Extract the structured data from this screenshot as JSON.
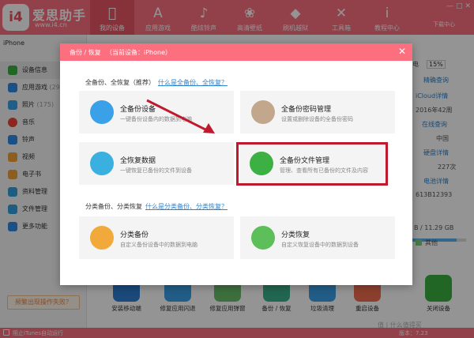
{
  "app": {
    "brand": "爱思助手",
    "url": "www.i4.cn",
    "logo_text": "i4"
  },
  "nav": [
    {
      "label": "我的设备",
      "icon": "apple-icon",
      "glyph": ""
    },
    {
      "label": "应用游戏",
      "icon": "app-store-icon",
      "glyph": "A"
    },
    {
      "label": "酷炫铃声",
      "icon": "bell-icon",
      "glyph": "♪"
    },
    {
      "label": "高清壁纸",
      "icon": "flower-icon",
      "glyph": "❀"
    },
    {
      "label": "刷机越狱",
      "icon": "dropbox-icon",
      "glyph": "◆"
    },
    {
      "label": "工具箱",
      "icon": "tools-icon",
      "glyph": "✕"
    },
    {
      "label": "教程中心",
      "icon": "info-icon",
      "glyph": "i"
    }
  ],
  "window_controls": "— □ ✕",
  "download_label": "下载中心",
  "sidebar": {
    "device": "iPhone",
    "items": [
      {
        "label": "设备信息",
        "count": "",
        "color": "#3cb043"
      },
      {
        "label": "应用游戏",
        "count": "(29)",
        "color": "#2e8be6"
      },
      {
        "label": "照片",
        "count": "(175)",
        "color": "#39a0e8"
      },
      {
        "label": "音乐",
        "count": "",
        "color": "#f0443a"
      },
      {
        "label": "铃声",
        "count": "",
        "color": "#2e8be6"
      },
      {
        "label": "视频",
        "count": "",
        "color": "#f2a33a"
      },
      {
        "label": "电子书",
        "count": "",
        "color": "#f2a33a"
      },
      {
        "label": "资料管理",
        "count": "",
        "color": "#33a0e0"
      },
      {
        "label": "文件管理",
        "count": "",
        "color": "#33a0e0"
      },
      {
        "label": "更多功能",
        "count": "",
        "color": "#2e8be6"
      }
    ],
    "fix_button": "频繁出现操作失败？"
  },
  "right_panel": {
    "battery_label": "电",
    "battery_pct": "15%",
    "lines": [
      "精确查询",
      "iCloud详情",
      "2016年42周",
      "在线查询",
      "中国",
      "硬盘详情",
      "227次",
      "电池详情",
      "613B12393"
    ],
    "storage_text": "B / 11.29 GB",
    "storage_fraction": 0.85,
    "legend": "其他"
  },
  "bottom_apps": [
    {
      "label": "安装移动端",
      "color": "#2d7fd3"
    },
    {
      "label": "修复应用闪退",
      "color": "#3aa0e8"
    },
    {
      "label": "修复应用弹窗",
      "color": "#6abf69"
    },
    {
      "label": "备份 / 恢复",
      "color": "#3ab08a"
    },
    {
      "label": "垃圾清理",
      "color": "#3aa0e8"
    },
    {
      "label": "重启设备",
      "color": "#f26d4f"
    },
    {
      "label": "关闭设备",
      "color": "#3cb043"
    }
  ],
  "statusbar": {
    "autostart": "阻止iTunes自动运行",
    "version": "版本：7.23"
  },
  "dialog": {
    "title": "备份 / 恢复",
    "subtitle": "（当前设备：iPhone）",
    "section1": "全备份、全恢复（推荐）",
    "section1_link": "什么是全备份、全恢复？",
    "section2": "分类备份、分类恢复",
    "section2_link": "什么是分类备份、分类恢复？",
    "cards": [
      {
        "title": "全备份设备",
        "desc": "一键备份设备内的数据到电脑",
        "color": "#3aa0e8",
        "icon": "clock-icon"
      },
      {
        "title": "全备份密码管理",
        "desc": "设置或删除设备的全备份密码",
        "color": "#c3a78c",
        "icon": "lock-icon"
      },
      {
        "title": "全恢复数据",
        "desc": "一键恢复已备份的文件到设备",
        "color": "#3ab0e0",
        "icon": "restore-icon"
      },
      {
        "title": "全备份文件管理",
        "desc": "管理、查看所有已备份的文件及内容",
        "color": "#3cb043",
        "icon": "folder-icon"
      },
      {
        "title": "分类备份",
        "desc": "自定义备份设备中的数据到电脑",
        "color": "#f0a93a",
        "icon": "backup-icon"
      },
      {
        "title": "分类恢复",
        "desc": "自定义恢复设备中的数据到设备",
        "color": "#5cbf5a",
        "icon": "restore-icon"
      }
    ]
  },
  "watermark": "值 | 什么值得买"
}
